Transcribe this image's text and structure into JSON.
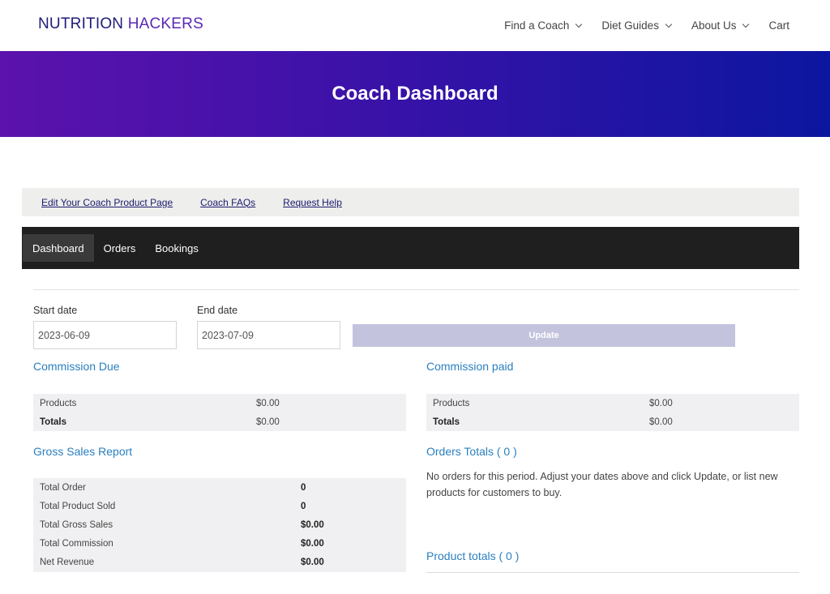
{
  "header": {
    "logo_word1": "NUTRITION",
    "logo_word2": "HACKERS",
    "nav": [
      {
        "label": "Find a Coach",
        "has_dropdown": true
      },
      {
        "label": "Diet Guides",
        "has_dropdown": true
      },
      {
        "label": "About Us",
        "has_dropdown": true
      },
      {
        "label": "Cart",
        "has_dropdown": false
      }
    ]
  },
  "hero": {
    "title": "Coach Dashboard"
  },
  "links": [
    "Edit Your Coach Product Page",
    "Coach FAQs",
    "Request Help"
  ],
  "tabs": [
    {
      "label": "Dashboard",
      "active": true
    },
    {
      "label": "Orders",
      "active": false
    },
    {
      "label": "Bookings",
      "active": false
    }
  ],
  "filters": {
    "start_label": "Start date",
    "start_value": "2023-06-09",
    "end_label": "End date",
    "end_value": "2023-07-09",
    "update_label": "Update"
  },
  "commission_due": {
    "title": "Commission Due",
    "rows": [
      {
        "label": "Products",
        "value": "$0.00"
      },
      {
        "label": "Totals",
        "value": "$0.00"
      }
    ]
  },
  "commission_paid": {
    "title": "Commission paid",
    "rows": [
      {
        "label": "Products",
        "value": "$0.00"
      },
      {
        "label": "Totals",
        "value": "$0.00"
      }
    ]
  },
  "gross_sales": {
    "title": "Gross Sales Report",
    "rows": [
      {
        "label": "Total Order",
        "value": "0"
      },
      {
        "label": "Total Product Sold",
        "value": "0"
      },
      {
        "label": "Total Gross Sales",
        "value": "$0.00"
      },
      {
        "label": "Total Commission",
        "value": "$0.00"
      },
      {
        "label": "Net Revenue",
        "value": "$0.00"
      }
    ]
  },
  "orders_totals": {
    "title": "Orders Totals ( 0 )",
    "message": "No orders for this period. Adjust your dates above and click Update, or list new products for customers to buy."
  },
  "product_totals": {
    "title": "Product totals ( 0 )"
  },
  "colors": {
    "accent": "#2a7fc0",
    "hero_start": "#5c12ad",
    "hero_end": "#0c16a0",
    "tabs_bg": "#1f1f1f"
  }
}
